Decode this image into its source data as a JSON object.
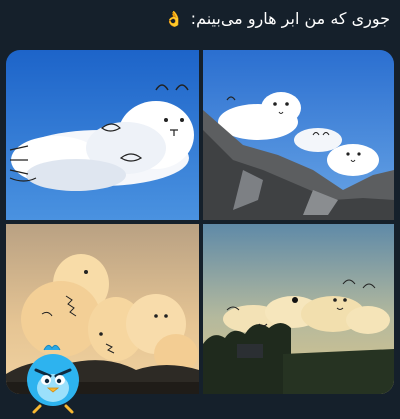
{
  "tweet": {
    "text": "جوری که من ابر هارو می‌بینم:",
    "emoji": "👌"
  },
  "media": {
    "photos": [
      {
        "icon": "cloud-cat-photo"
      },
      {
        "icon": "cloud-dogs-mountain-photo"
      },
      {
        "icon": "cloud-dinosaur-sunset-photo"
      },
      {
        "icon": "cloud-animals-treeline-photo"
      }
    ]
  },
  "overlay": {
    "icon": "angry-bird-sticker"
  },
  "colors": {
    "background": "#15202b",
    "text": "#ffffff"
  }
}
